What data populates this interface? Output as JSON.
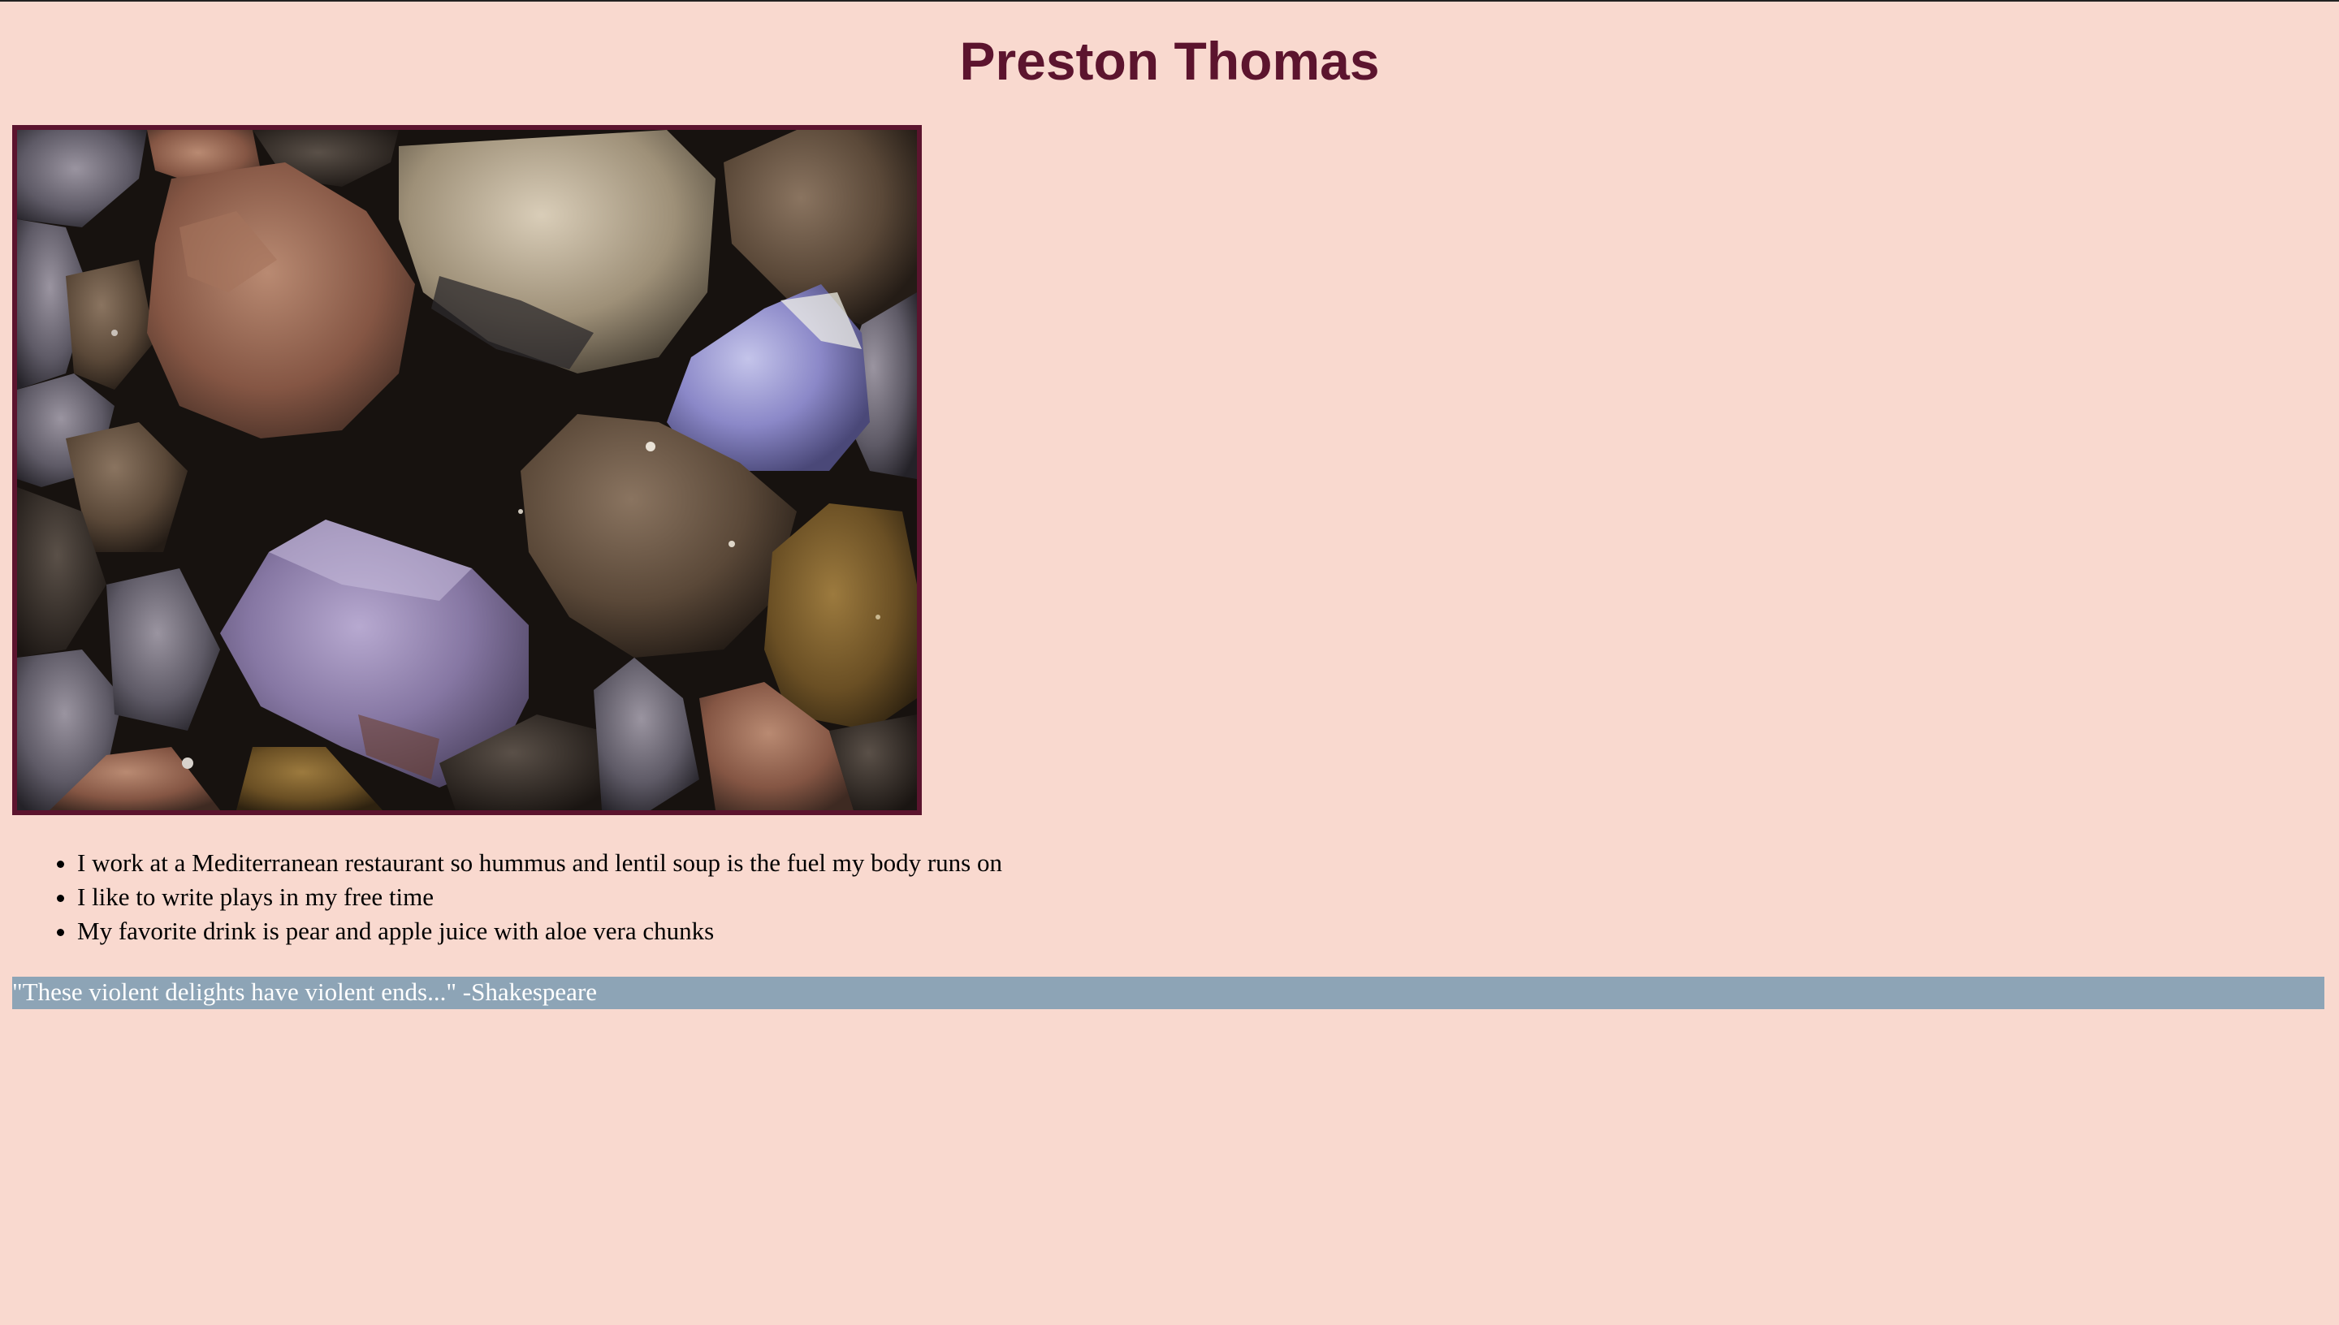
{
  "header": {
    "title": "Preston Thomas"
  },
  "photo": {
    "subject": "rough gemstone rocks",
    "border_color": "#5c142e"
  },
  "facts": {
    "items": [
      "I work at a Mediterranean restaurant so hummus and lentil soup is the fuel my body runs on",
      "I like to write plays in my free time",
      "My favorite drink is pear and apple juice with aloe vera chunks"
    ]
  },
  "quote": {
    "text": "\"These violent delights have violent ends...\" -Shakespeare"
  },
  "colors": {
    "background": "#f9d9cf",
    "title": "#5c142e",
    "quote_bar": "#8da4b6",
    "quote_text": "#ffffff"
  }
}
